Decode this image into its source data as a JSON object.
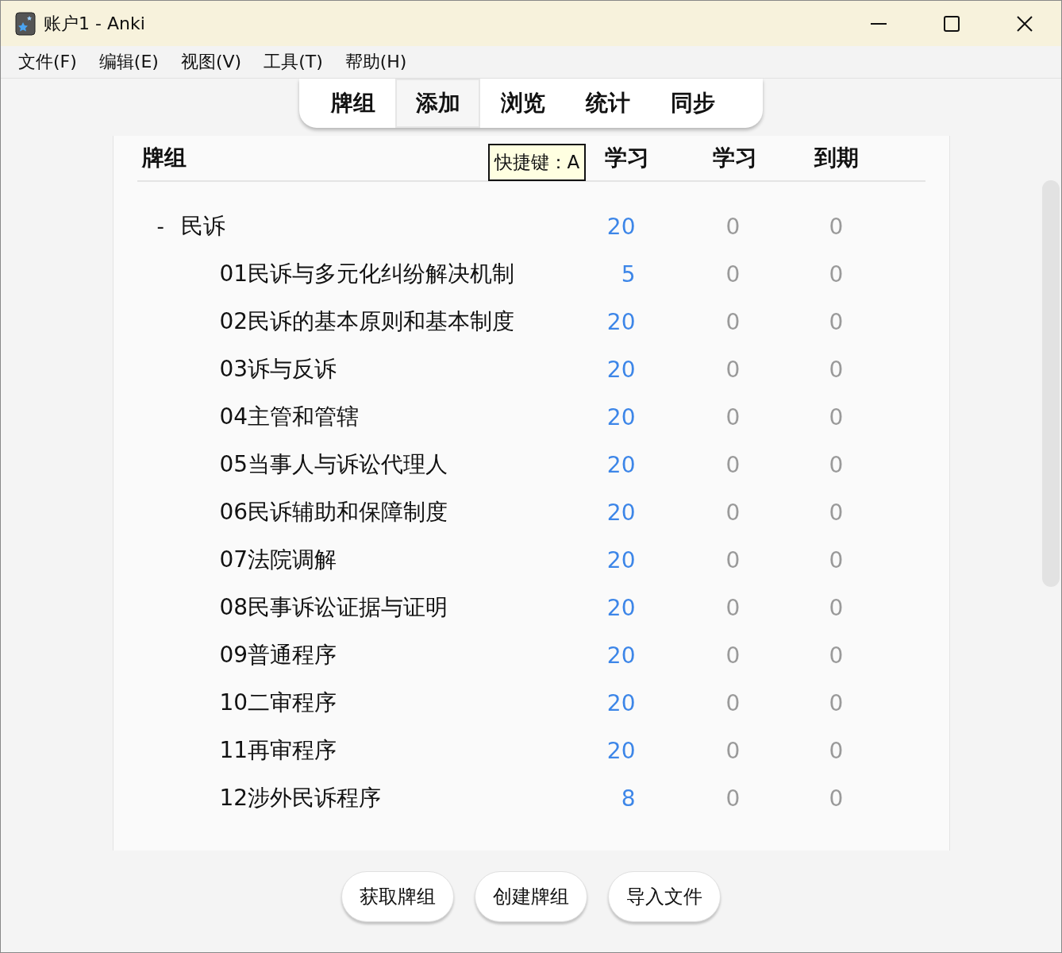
{
  "window": {
    "title": "账户1 - Anki"
  },
  "menu": [
    "文件(F)",
    "编辑(E)",
    "视图(V)",
    "工具(T)",
    "帮助(H)"
  ],
  "toolbar": [
    {
      "label": "牌组",
      "selected": false
    },
    {
      "label": "添加",
      "selected": true
    },
    {
      "label": "浏览",
      "selected": false
    },
    {
      "label": "统计",
      "selected": false
    },
    {
      "label": "同步",
      "selected": false
    }
  ],
  "tooltip": "快捷键：A",
  "table": {
    "columns": [
      "牌组",
      "学习",
      "学习",
      "到期"
    ],
    "rows": [
      {
        "name": "民诉",
        "toggle": "-",
        "expanded": true,
        "new": "20",
        "learn": "0",
        "due": "0",
        "children": [
          {
            "name": "01民诉与多元化纠纷解决机制",
            "new": "5",
            "learn": "0",
            "due": "0"
          },
          {
            "name": "02民诉的基本原则和基本制度",
            "new": "20",
            "learn": "0",
            "due": "0"
          },
          {
            "name": "03诉与反诉",
            "new": "20",
            "learn": "0",
            "due": "0"
          },
          {
            "name": "04主管和管辖",
            "new": "20",
            "learn": "0",
            "due": "0"
          },
          {
            "name": "05当事人与诉讼代理人",
            "new": "20",
            "learn": "0",
            "due": "0"
          },
          {
            "name": "06民诉辅助和保障制度",
            "new": "20",
            "learn": "0",
            "due": "0"
          },
          {
            "name": "07法院调解",
            "new": "20",
            "learn": "0",
            "due": "0"
          },
          {
            "name": "08民事诉讼证据与证明",
            "new": "20",
            "learn": "0",
            "due": "0"
          },
          {
            "name": "09普通程序",
            "new": "20",
            "learn": "0",
            "due": "0"
          },
          {
            "name": "10二审程序",
            "new": "20",
            "learn": "0",
            "due": "0"
          },
          {
            "name": "11再审程序",
            "new": "20",
            "learn": "0",
            "due": "0"
          },
          {
            "name": "12涉外民诉程序",
            "new": "8",
            "learn": "0",
            "due": "0"
          }
        ]
      }
    ]
  },
  "buttons": [
    "获取牌组",
    "创建牌组",
    "导入文件"
  ]
}
